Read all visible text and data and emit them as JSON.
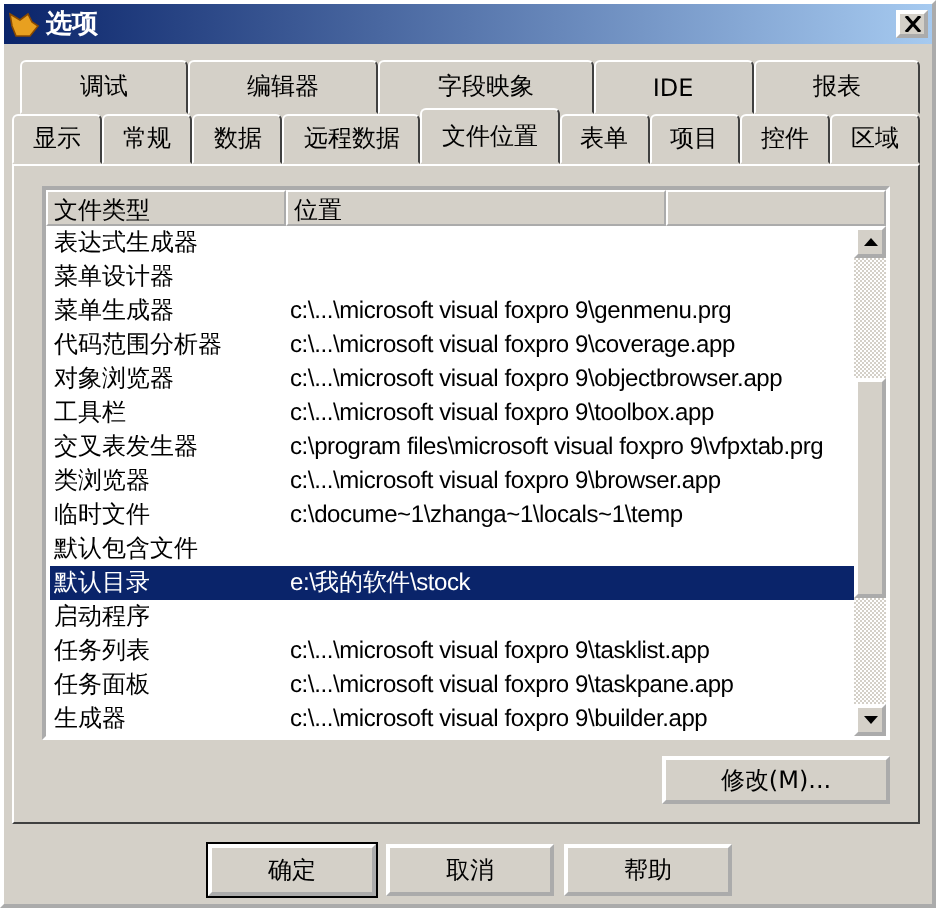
{
  "window": {
    "title": "选项"
  },
  "tab_rows": [
    [
      {
        "label": "调试",
        "selected": false
      },
      {
        "label": "编辑器",
        "selected": false
      },
      {
        "label": "字段映象",
        "selected": false
      },
      {
        "label": "IDE",
        "selected": false
      },
      {
        "label": "报表",
        "selected": false
      }
    ],
    [
      {
        "label": "显示",
        "selected": false
      },
      {
        "label": "常规",
        "selected": false
      },
      {
        "label": "数据",
        "selected": false
      },
      {
        "label": "远程数据",
        "selected": false
      },
      {
        "label": "文件位置",
        "selected": true
      },
      {
        "label": "表单",
        "selected": false
      },
      {
        "label": "项目",
        "selected": false
      },
      {
        "label": "控件",
        "selected": false
      },
      {
        "label": "区域",
        "selected": false
      }
    ]
  ],
  "table": {
    "columns": [
      "文件类型",
      "位置"
    ],
    "rows": [
      {
        "type": "表达式生成器",
        "location": "",
        "selected": false
      },
      {
        "type": "菜单设计器",
        "location": "",
        "selected": false
      },
      {
        "type": "菜单生成器",
        "location": "c:\\...\\microsoft visual foxpro 9\\genmenu.prg",
        "selected": false
      },
      {
        "type": "代码范围分析器",
        "location": "c:\\...\\microsoft visual foxpro 9\\coverage.app",
        "selected": false
      },
      {
        "type": "对象浏览器",
        "location": "c:\\...\\microsoft visual foxpro 9\\objectbrowser.app",
        "selected": false
      },
      {
        "type": "工具栏",
        "location": "c:\\...\\microsoft visual foxpro 9\\toolbox.app",
        "selected": false
      },
      {
        "type": "交叉表发生器",
        "location": "c:\\program files\\microsoft visual foxpro 9\\vfpxtab.prg",
        "selected": false
      },
      {
        "type": "类浏览器",
        "location": "c:\\...\\microsoft visual foxpro 9\\browser.app",
        "selected": false
      },
      {
        "type": "临时文件",
        "location": "c:\\docume~1\\zhanga~1\\locals~1\\temp",
        "selected": false
      },
      {
        "type": "默认包含文件",
        "location": "",
        "selected": false
      },
      {
        "type": "默认目录",
        "location": "e:\\我的软件\\stock",
        "selected": true
      },
      {
        "type": "启动程序",
        "location": "",
        "selected": false
      },
      {
        "type": "任务列表",
        "location": "c:\\...\\microsoft visual foxpro 9\\tasklist.app",
        "selected": false
      },
      {
        "type": "任务面板",
        "location": "c:\\...\\microsoft visual foxpro 9\\taskpane.app",
        "selected": false
      },
      {
        "type": "生成器",
        "location": "c:\\...\\microsoft visual foxpro 9\\builder.app",
        "selected": false
      }
    ]
  },
  "modify_button": "修改(M)...",
  "buttons": [
    {
      "label": "确定",
      "default": true
    },
    {
      "label": "取消",
      "default": false
    },
    {
      "label": "帮助",
      "default": false
    }
  ]
}
